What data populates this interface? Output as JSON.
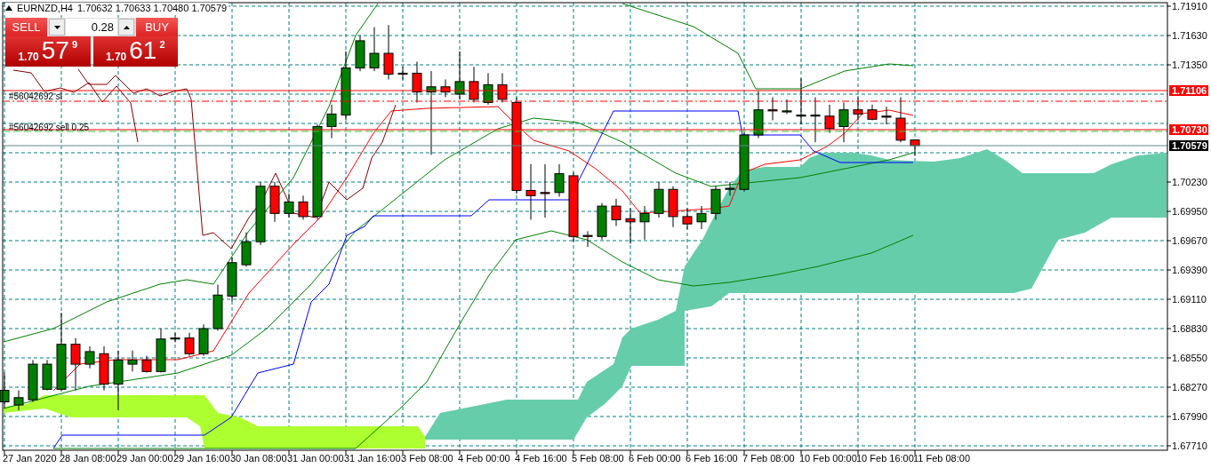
{
  "header": {
    "symbol": "EURNZD,H4",
    "ohlc": "1.70632 1.70633 1.70480 1.70579"
  },
  "trade_panel": {
    "sell_label": "SELL",
    "buy_label": "BUY",
    "volume": "0.28",
    "sell_price": {
      "prefix": "1.70",
      "big": "57",
      "pip": "9"
    },
    "buy_price": {
      "prefix": "1.70",
      "big": "61",
      "pip": "2"
    }
  },
  "order_lines": [
    {
      "kind": "sl",
      "label": "#56042692 sl"
    },
    {
      "kind": "open",
      "label": "#56042692 sell 0.25"
    }
  ],
  "price_tags": [
    {
      "kind": "sl",
      "text": "1.71106"
    },
    {
      "kind": "open",
      "text": "1.70730"
    },
    {
      "kind": "bid",
      "text": "1.70579"
    }
  ],
  "price_axis": {
    "labels": [
      "1.71910",
      "1.71630",
      "1.71350",
      "1.70230",
      "1.69950",
      "1.69670",
      "1.69390",
      "1.69110",
      "1.68830",
      "1.68550",
      "1.68270",
      "1.67990",
      "1.67710"
    ]
  },
  "time_axis": {
    "labels": [
      "27 Jan 2020",
      "28 Jan 08:00",
      "29 Jan 00:00",
      "29 Jan 16:00",
      "30 Jan 08:00",
      "31 Jan 00:00",
      "31 Jan 16:00",
      "3 Feb 08:00",
      "4 Feb 00:00",
      "4 Feb 16:00",
      "5 Feb 08:00",
      "6 Feb 00:00",
      "6 Feb 16:00",
      "7 Feb 08:00",
      "10 Feb 00:00",
      "10 Feb 16:00",
      "11 Feb 08:00"
    ]
  }
}
